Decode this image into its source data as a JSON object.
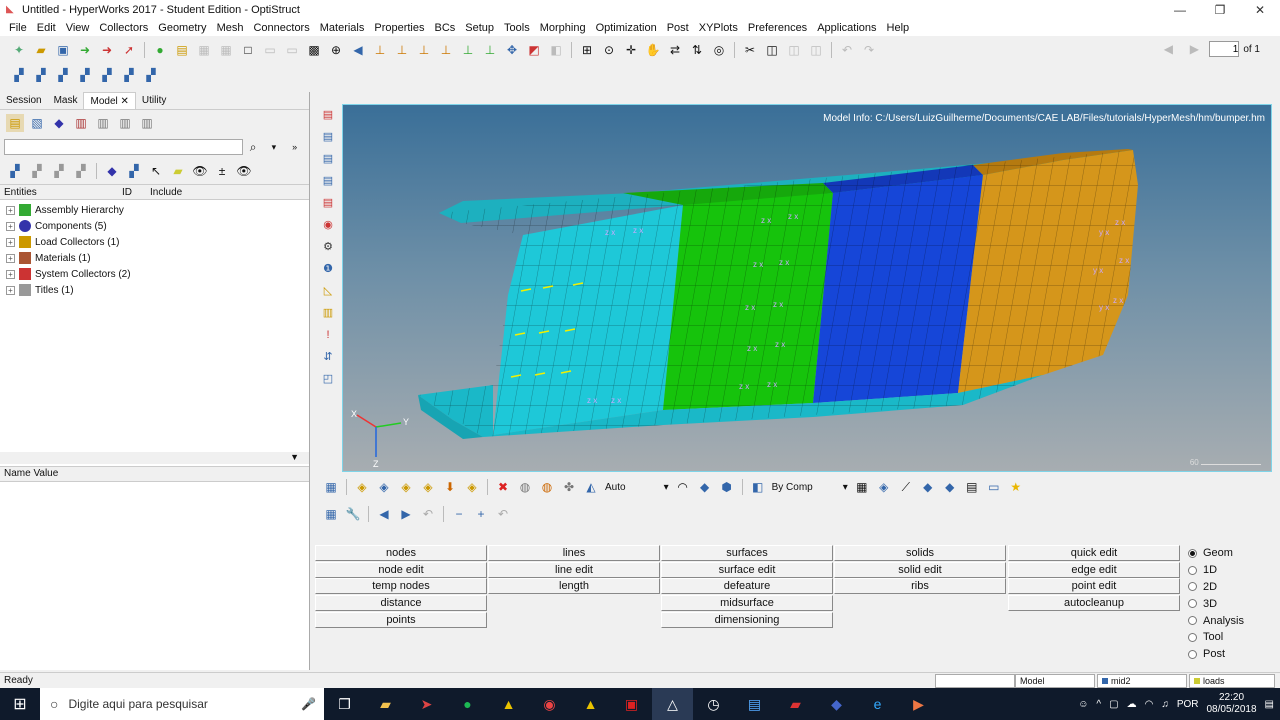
{
  "window": {
    "title": "Untitled - HyperWorks 2017 - Student Edition - OptiStruct",
    "minimize_icon": "minimize-icon",
    "maximize_icon": "maximize-icon",
    "close_icon": "close-icon"
  },
  "menu": [
    "File",
    "Edit",
    "View",
    "Collectors",
    "Geometry",
    "Mesh",
    "Connectors",
    "Materials",
    "Properties",
    "BCs",
    "Setup",
    "Tools",
    "Morphing",
    "Optimization",
    "Post",
    "XYPlots",
    "Preferences",
    "Applications",
    "Help"
  ],
  "page_nav": {
    "current": "1",
    "of_label": "of 1"
  },
  "left_panel": {
    "tabs": [
      "Session",
      "Mask",
      "Model",
      "Utility"
    ],
    "active_tab": "Model",
    "filter_placeholder": "",
    "entity_header": {
      "entities": "Entities",
      "id": "ID",
      "include": "Include"
    },
    "entities": [
      {
        "label": "Assembly Hierarchy",
        "icon": "assembly-icon"
      },
      {
        "label": "Components (5)",
        "icon": "components-icon"
      },
      {
        "label": "Load Collectors (1)",
        "icon": "load-collector-icon"
      },
      {
        "label": "Materials (1)",
        "icon": "material-icon"
      },
      {
        "label": "System Collectors (2)",
        "icon": "system-collector-icon"
      },
      {
        "label": "Titles (1)",
        "icon": "titles-icon"
      }
    ],
    "name_value_header": "Name Value"
  },
  "viewport": {
    "model_info": "Model Info: C:/Users/LuizGuilherme/Documents/CAE LAB/Files/tutorials/HyperMesh/hm/bumper.hm",
    "scale_label": "60",
    "triad": {
      "x": "X",
      "y": "Y",
      "z": "Z"
    },
    "colors": {
      "cyan": "#1ec8d8",
      "green": "#16c30c",
      "blue": "#1646d8",
      "orange": "#d5961b"
    }
  },
  "view_toolbar": {
    "display_mode": "Auto",
    "color_mode": "By Comp"
  },
  "panel": {
    "columns": [
      [
        "nodes",
        "node edit",
        "temp nodes",
        "distance",
        "points"
      ],
      [
        "lines",
        "line edit",
        "length"
      ],
      [
        "surfaces",
        "surface edit",
        "defeature",
        "midsurface",
        "dimensioning"
      ],
      [
        "solids",
        "solid edit",
        "ribs"
      ],
      [
        "quick edit",
        "edge edit",
        "point edit",
        "autocleanup"
      ]
    ],
    "radio_options": [
      "Geom",
      "1D",
      "2D",
      "3D",
      "Analysis",
      "Tool",
      "Post"
    ],
    "radio_selected": "Geom"
  },
  "status_bar": {
    "status": "Ready",
    "model": "Model",
    "component": "mid2",
    "load_collector": "loads"
  },
  "taskbar": {
    "search_placeholder": "Digite aqui para pesquisar",
    "language": "POR",
    "time": "22:20",
    "date": "08/05/2018"
  }
}
